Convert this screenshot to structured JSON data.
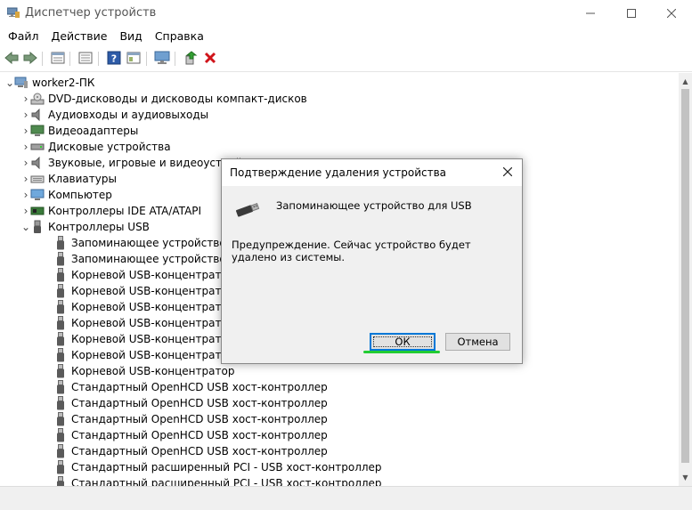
{
  "window": {
    "title": "Диспетчер устройств",
    "minimize_icon": "minimize-icon",
    "maximize_icon": "maximize-icon",
    "close_icon": "close-icon"
  },
  "menu": [
    "Файл",
    "Действие",
    "Вид",
    "Справка"
  ],
  "toolbar": {
    "icons": [
      "back-arrow-icon",
      "forward-arrow-icon",
      "properties-icon",
      "list-icon",
      "help-icon",
      "view-icon",
      "monitor-icon",
      "update-driver-icon",
      "uninstall-icon"
    ]
  },
  "tree": {
    "root": "worker2-ПК",
    "categories": [
      {
        "label": "DVD-дисководы и дисководы компакт-дисков",
        "icon": "dvd-drive-icon"
      },
      {
        "label": "Аудиовходы и аудиовыходы",
        "icon": "speaker-icon"
      },
      {
        "label": "Видеоадаптеры",
        "icon": "display-adapter-icon"
      },
      {
        "label": "Дисковые устройства",
        "icon": "disk-drive-icon"
      },
      {
        "label": "Звуковые, игровые и видеоустройства",
        "icon": "speaker-icon"
      },
      {
        "label": "Клавиатуры",
        "icon": "keyboard-icon"
      },
      {
        "label": "Компьютер",
        "icon": "computer-icon"
      },
      {
        "label": "Контроллеры IDE ATA/ATAPI",
        "icon": "ide-controller-icon"
      },
      {
        "label": "Контроллеры USB",
        "icon": "usb-icon"
      }
    ],
    "usb_children": [
      "Запоминающее устройство для USB",
      "Запоминающее устройство для USB",
      "Корневой USB-концентратор",
      "Корневой USB-концентратор",
      "Корневой USB-концентратор",
      "Корневой USB-концентратор",
      "Корневой USB-концентратор",
      "Корневой USB-концентратор",
      "Корневой USB-концентратор",
      "Стандартный OpenHCD USB хост-контроллер",
      "Стандартный OpenHCD USB хост-контроллер",
      "Стандартный OpenHCD USB хост-контроллер",
      "Стандартный OpenHCD USB хост-контроллер",
      "Стандартный OpenHCD USB хост-контроллер",
      "Стандартный расширенный PCI - USB хост-контроллер",
      "Стандартный расширенный PCI - USB хост-контроллер"
    ]
  },
  "dialog": {
    "title": "Подтверждение удаления устройства",
    "device_name": "Запоминающее устройство для USB",
    "warning": "Предупреждение. Сейчас устройство будет удалено из системы.",
    "ok_label": "ОК",
    "cancel_label": "Отмена"
  },
  "colors": {
    "accent": "#0078d7",
    "highlight_underline": "#22cc33",
    "dialog_bg": "#f0f0f0"
  }
}
